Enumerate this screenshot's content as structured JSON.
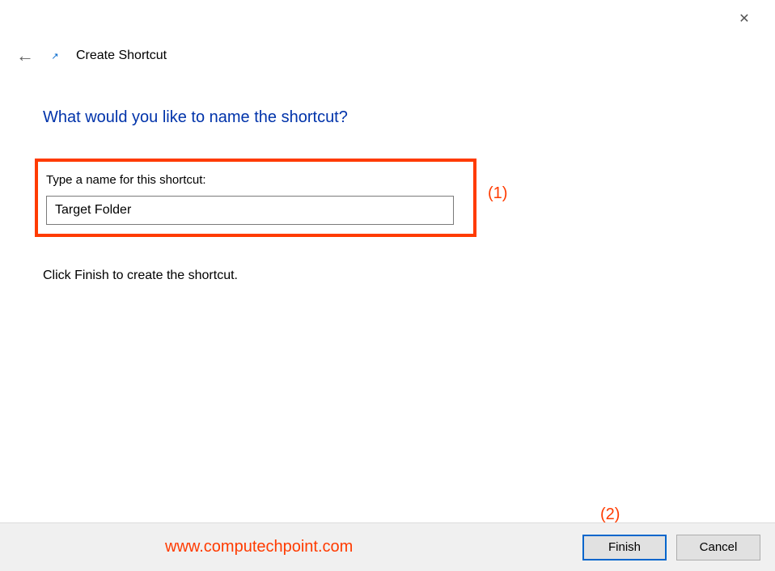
{
  "window": {
    "close_glyph": "✕",
    "back_glyph": "←",
    "shortcut_glyph": "↗",
    "title": "Create Shortcut"
  },
  "content": {
    "heading": "What would you like to name the shortcut?",
    "field_label": "Type a name for this shortcut:",
    "name_value": "Target Folder",
    "instruction": "Click Finish to create the shortcut."
  },
  "footer": {
    "watermark": "www.computechpoint.com",
    "finish_label": "Finish",
    "cancel_label": "Cancel"
  },
  "annotations": {
    "label1": "(1)",
    "label2": "(2)"
  }
}
